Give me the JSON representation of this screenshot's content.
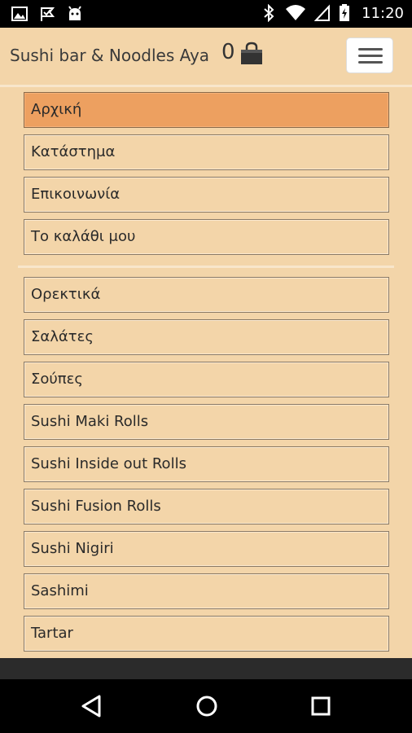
{
  "status_bar": {
    "time": "11:20",
    "left_icons": [
      "image-icon",
      "flag-icon",
      "android-icon"
    ],
    "right_icons": [
      "bluetooth-icon",
      "wifi-icon",
      "signal-icon",
      "battery-icon"
    ]
  },
  "header": {
    "title": "Sushi bar & Noodles Aya",
    "cart_count": "0"
  },
  "menu": {
    "main_items": [
      {
        "label": "Αρχική",
        "active": true
      },
      {
        "label": "Κατάστημα"
      },
      {
        "label": "Επικοινωνία"
      },
      {
        "label": "Το καλάθι μου"
      }
    ],
    "category_items": [
      {
        "label": "Ορεκτικά"
      },
      {
        "label": "Σαλάτες"
      },
      {
        "label": "Σούπες"
      },
      {
        "label": "Sushi Maki Rolls"
      },
      {
        "label": "Sushi Inside out Rolls"
      },
      {
        "label": "Sushi Fusion Rolls"
      },
      {
        "label": "Sushi Nigiri"
      },
      {
        "label": "Sashimi"
      },
      {
        "label": "Tartar"
      }
    ]
  },
  "nav_bar": {
    "buttons": [
      "back-icon",
      "home-icon",
      "recents-icon"
    ]
  },
  "colors": {
    "background": "#f3d5a9",
    "active_item": "#eda060",
    "status_bar": "#000000"
  }
}
